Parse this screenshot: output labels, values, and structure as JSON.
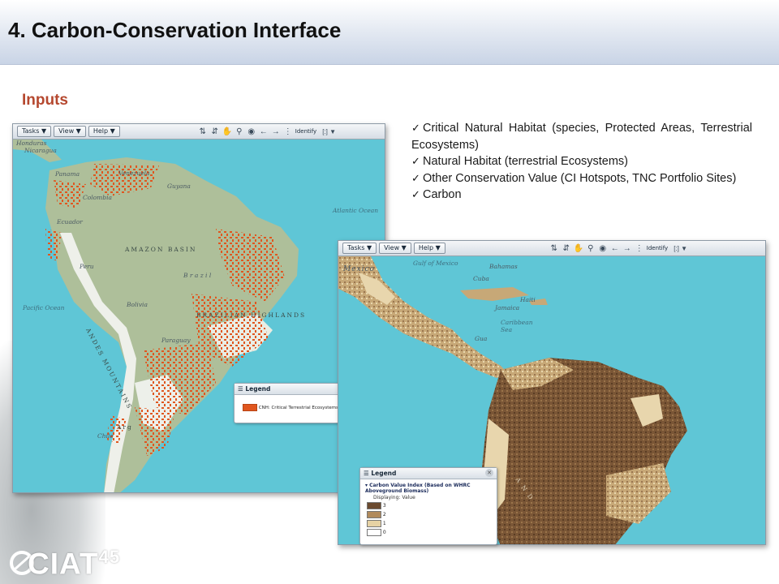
{
  "slide": {
    "title": "4. Carbon-Conservation Interface",
    "section": "Inputs"
  },
  "bullets": [
    "Critical Natural Habitat (species, Protected Areas, Terrestrial Ecosystems)",
    "Natural Habitat (terrestrial Ecosystems)",
    "Other Conservation Value (CI Hotspots, TNC Portfolio Sites)",
    "Carbon"
  ],
  "toolbar": {
    "tasks": "Tasks ▼",
    "view": "View ▼",
    "help": "Help ▼",
    "identify": "Identify",
    "selection": "[:] ▼"
  },
  "map1": {
    "labels": {
      "honduras": "Honduras",
      "nicaragua": "Nicaragua",
      "panama": "Panama",
      "colombia": "Colombia",
      "venezuela": "Venezuela",
      "guyana": "Guyana",
      "ecuador": "Ecuador",
      "amazon": "AMAZON BASIN",
      "peru": "Peru",
      "brazil": "B r a z i l",
      "bolivia": "Bolivia",
      "highlands": "BRAZILIAN HIGHLANDS",
      "pacific": "Pacific Ocean",
      "atlantic": "Atlantic Ocean",
      "andes": "ANDES MOUNTAINS",
      "paraguay": "Paraguay",
      "chile": "Chile",
      "arg": "Arg"
    },
    "legend": {
      "title": "Legend",
      "entry": "CNH: Critical Terrestrial Ecosystems",
      "color": "#e0561f"
    }
  },
  "map2": {
    "labels": {
      "mexico": "Mexico",
      "gulf": "Gulf of Mexico",
      "bahamas": "Bahamas",
      "cuba": "Cuba",
      "haiti": "Haiti",
      "jamaica": "Jamaica",
      "caribbean": "Caribbean Sea",
      "gua": "Gua",
      "and": "A N D"
    },
    "legend": {
      "title": "Legend",
      "layer": "Carbon Value Index (Based on WHRC Aboveground Biomass)",
      "displaying": "Displaying: Value",
      "classes": [
        {
          "value": "3",
          "color": "#6b4a2f"
        },
        {
          "value": "2",
          "color": "#b18a5c"
        },
        {
          "value": "1",
          "color": "#e6d2a4"
        },
        {
          "value": "0",
          "color": "#ffffff"
        }
      ]
    }
  },
  "logo": {
    "text": "CIAT",
    "suffix": "45"
  },
  "colors": {
    "accent": "#b5482f",
    "ocean": "#5fc6d6",
    "land": "#aebf9a"
  }
}
